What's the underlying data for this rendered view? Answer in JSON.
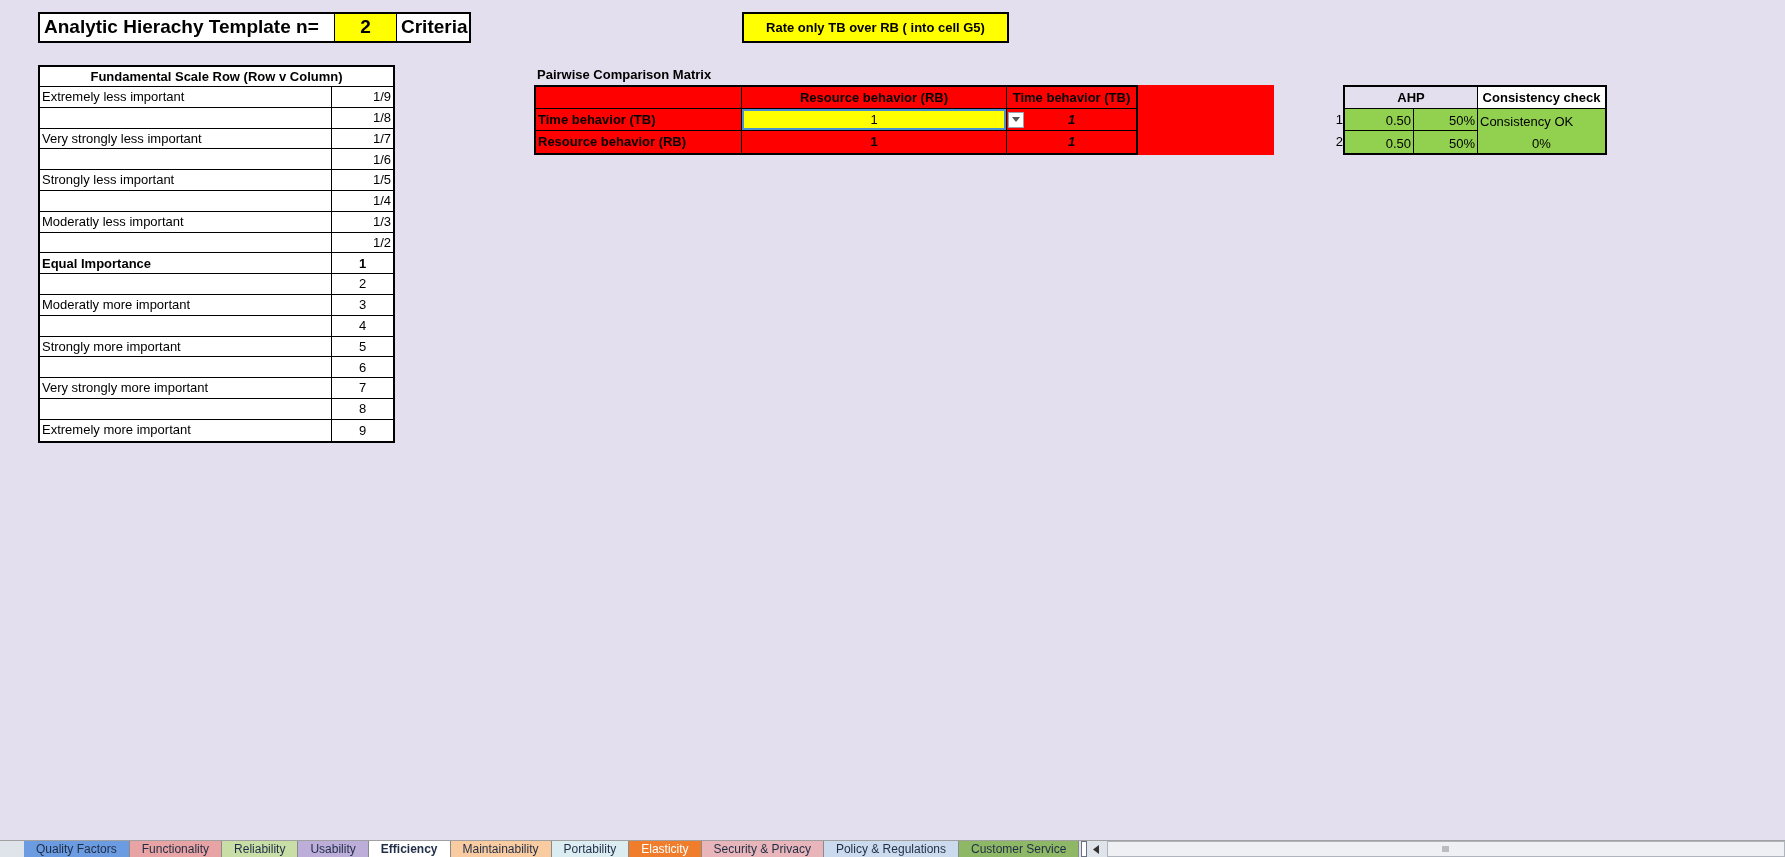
{
  "header": {
    "title": "Analytic Hierachy Template n=",
    "n": "2",
    "suffix": "Criteria"
  },
  "note": "Rate only TB over RB ( into cell G5)",
  "scale_table": {
    "title": "Fundamental Scale Row (Row v Column)",
    "rows": [
      {
        "label": "Extremely less important",
        "value": "1/9",
        "bold": false
      },
      {
        "label": "",
        "value": "1/8",
        "bold": false
      },
      {
        "label": "Very strongly less important",
        "value": "1/7",
        "bold": false
      },
      {
        "label": "",
        "value": "1/6",
        "bold": false
      },
      {
        "label": "Strongly less important",
        "value": "1/5",
        "bold": false
      },
      {
        "label": "",
        "value": "1/4",
        "bold": false
      },
      {
        "label": "Moderatly less important",
        "value": "1/3",
        "bold": false
      },
      {
        "label": "",
        "value": "1/2",
        "bold": false
      },
      {
        "label": "Equal Importance",
        "value": "1",
        "bold": true
      },
      {
        "label": "",
        "value": "2",
        "bold": false
      },
      {
        "label": "Moderatly more important",
        "value": "3",
        "bold": false
      },
      {
        "label": "",
        "value": "4",
        "bold": false
      },
      {
        "label": "Strongly more important",
        "value": "5",
        "bold": false
      },
      {
        "label": "",
        "value": "6",
        "bold": false
      },
      {
        "label": "Very strongly more important",
        "value": "7",
        "bold": false
      },
      {
        "label": "",
        "value": "8",
        "bold": false
      },
      {
        "label": "Extremely more important",
        "value": "9",
        "bold": false
      }
    ]
  },
  "matrix": {
    "title": "Pairwise Comparison Matrix",
    "columns": [
      "Resource behavior (RB)",
      "Time behavior (TB)"
    ],
    "rows": [
      {
        "label": "Time behavior (TB)",
        "cells": [
          "1",
          "1"
        ]
      },
      {
        "label": "Resource behavior (RB)",
        "cells": [
          "1",
          "1"
        ]
      }
    ]
  },
  "ahp": {
    "title": "AHP",
    "check_title": "Consistency check",
    "rows": [
      {
        "index": "1",
        "weight": "0.50",
        "percent": "50%",
        "check": "Consistency OK"
      },
      {
        "index": "2",
        "weight": "0.50",
        "percent": "50%",
        "check": "0%"
      }
    ]
  },
  "sheet_tabs": [
    {
      "label": "Quality Factors",
      "color": "#6b9be0",
      "selected": false
    },
    {
      "label": "Functionality",
      "color": "#e8a4a4",
      "selected": false
    },
    {
      "label": "Reliability",
      "color": "#c8dea6",
      "selected": false
    },
    {
      "label": "Usability",
      "color": "#bcaed8",
      "selected": false
    },
    {
      "label": "Efficiency",
      "selected": true
    },
    {
      "label": "Maintainability",
      "color": "#f9cba0",
      "selected": false
    },
    {
      "label": "Portability",
      "color": "#dcedf2",
      "selected": false
    },
    {
      "label": "Elasticity",
      "color": "#f07d2c",
      "selected": false
    },
    {
      "label": "Security & Privacy",
      "color": "#e8b6ba",
      "selected": false
    },
    {
      "label": "Policy & Regulations",
      "color": "#ccdaee",
      "selected": false
    },
    {
      "label": "Customer Service",
      "color": "#8fb866",
      "selected": false
    }
  ]
}
